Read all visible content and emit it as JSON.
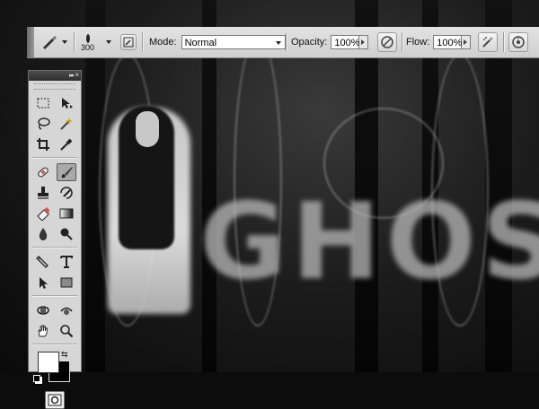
{
  "options_bar": {
    "brush_size": "300",
    "mode_label": "Mode:",
    "mode_value": "Normal",
    "opacity_label": "Opacity:",
    "opacity_value": "100%",
    "flow_label": "Flow:",
    "flow_value": "100%",
    "icons": [
      "brush-preset-icon",
      "brush-panel-toggle-icon",
      "pressure-opacity-icon",
      "airbrush-icon",
      "pressure-size-icon"
    ]
  },
  "canvas": {
    "text": "GHOST"
  },
  "tools_panel": {
    "header_collapse": "▸▸",
    "header_close": "×",
    "tools": [
      [
        "marquee-tool-icon",
        "move-tool-icon"
      ],
      [
        "lasso-tool-icon",
        "magic-wand-tool-icon"
      ],
      [
        "crop-tool-icon",
        "eyedropper-tool-icon"
      ],
      [
        "healing-brush-tool-icon",
        "brush-tool-icon"
      ],
      [
        "clone-stamp-tool-icon",
        "history-brush-tool-icon"
      ],
      [
        "eraser-tool-icon",
        "gradient-tool-icon"
      ],
      [
        "blur-tool-icon",
        "dodge-tool-icon"
      ],
      [
        "pen-tool-icon",
        "type-tool-icon"
      ],
      [
        "path-selection-tool-icon",
        "rectangle-tool-icon"
      ],
      [
        "3d-rotate-tool-icon",
        "3d-orbit-tool-icon"
      ],
      [
        "hand-tool-icon",
        "zoom-tool-icon"
      ]
    ],
    "active_tool": "brush-tool-icon",
    "foreground_color": "#ffffff",
    "background_color": "#000000"
  },
  "colors": {
    "panel_bg": "#d6d6d6",
    "options_bg": "#dadada",
    "header_dark": "#3a3a3a"
  }
}
